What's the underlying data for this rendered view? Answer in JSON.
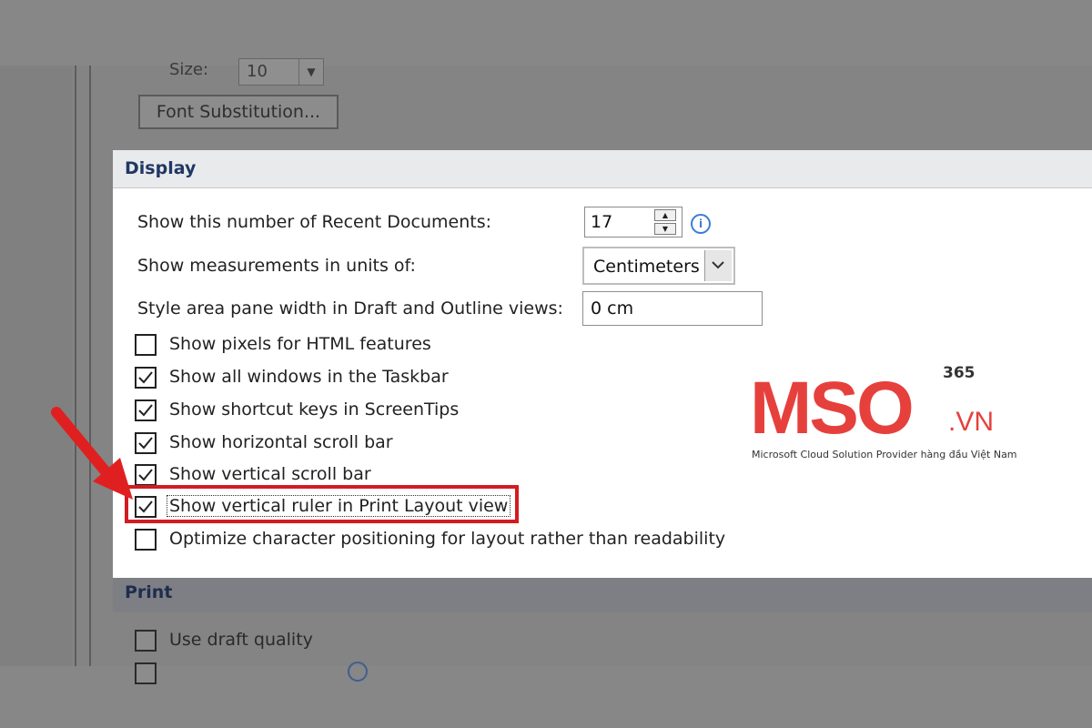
{
  "font": {
    "size_label": "Size:",
    "size_value": "10",
    "font_substitution_button": "Font Substitution..."
  },
  "display": {
    "title": "Display",
    "recent_docs_label": "Show this number of Recent Documents:",
    "recent_docs_value": "17",
    "measurements_label": "Show measurements in units of:",
    "measurements_value": "Centimeters",
    "style_area_label": "Style area pane width in Draft and Outline views:",
    "style_area_value": "0 cm",
    "checkboxes": [
      {
        "label": "Show pixels for HTML features",
        "checked": false
      },
      {
        "label": "Show all windows in the Taskbar",
        "checked": true
      },
      {
        "label": "Show shortcut keys in ScreenTips",
        "checked": true
      },
      {
        "label": "Show horizontal scroll bar",
        "checked": true
      },
      {
        "label": "Show vertical scroll bar",
        "checked": true
      },
      {
        "label": "Show vertical ruler in Print Layout view",
        "checked": true
      },
      {
        "label": "Optimize character positioning for layout rather than readability",
        "checked": false
      }
    ]
  },
  "print": {
    "title": "Print",
    "draft_quality_label": "Use draft quality"
  },
  "watermark": {
    "brand": "MSO",
    "superscript": "365",
    "suffix": ".VN",
    "tagline": "Microsoft Cloud Solution Provider hàng đầu Việt Nam"
  },
  "colors": {
    "highlight": "#d31b22",
    "brand": "#e6403d",
    "section_title": "#1f3864"
  }
}
